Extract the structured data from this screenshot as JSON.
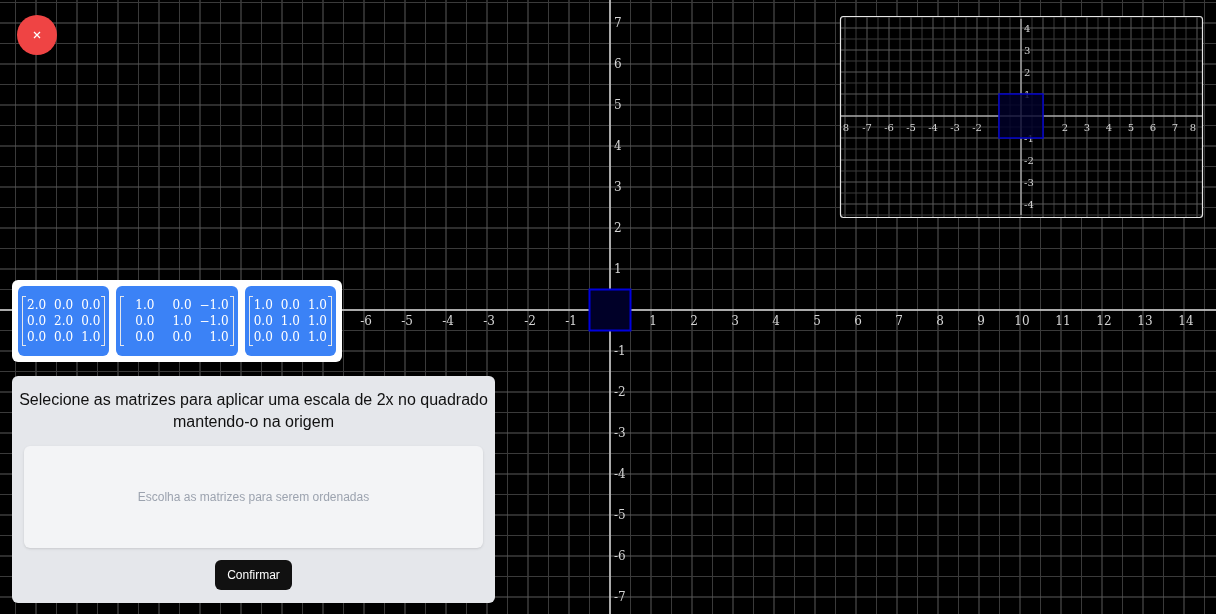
{
  "plane": {
    "x_labels": [
      "-6",
      "-5",
      "-4",
      "-3",
      "-2",
      "-1",
      "1",
      "2",
      "3",
      "4",
      "5",
      "6",
      "7",
      "8",
      "9",
      "10",
      "11",
      "12",
      "13",
      "14"
    ],
    "y_labels": [
      "7",
      "6",
      "5",
      "4",
      "3",
      "2",
      "1",
      "-1",
      "-2",
      "-3",
      "-4",
      "-5",
      "-6",
      "-7"
    ]
  },
  "preview": {
    "x_labels": [
      "8",
      "-7",
      "-6",
      "-5",
      "-4",
      "-3",
      "-2",
      "2",
      "3",
      "4",
      "5",
      "6",
      "7",
      "8"
    ],
    "y_labels": [
      "4",
      "3",
      "2",
      "1",
      "-1",
      "-2",
      "-3",
      "-4"
    ]
  },
  "matrices": [
    {
      "rows": [
        [
          "2.0",
          "0.0",
          "0.0"
        ],
        [
          "0.0",
          "2.0",
          "0.0"
        ],
        [
          "0.0",
          "0.0",
          "1.0"
        ]
      ]
    },
    {
      "rows": [
        [
          "1.0",
          "0.0",
          "−1.0"
        ],
        [
          "0.0",
          "1.0",
          "−1.0"
        ],
        [
          "0.0",
          "0.0",
          "1.0"
        ]
      ]
    },
    {
      "rows": [
        [
          "1.0",
          "0.0",
          "1.0"
        ],
        [
          "0.0",
          "1.0",
          "1.0"
        ],
        [
          "0.0",
          "0.0",
          "1.0"
        ]
      ]
    }
  ],
  "task": {
    "prompt": "Selecione as matrizes para aplicar uma escala de 2x no quadrado mantendo-o na origem",
    "drop_zone": {
      "placeholder": "Escolha as matrizes para serem ordenadas"
    },
    "confirm_button": "Confirmar"
  }
}
